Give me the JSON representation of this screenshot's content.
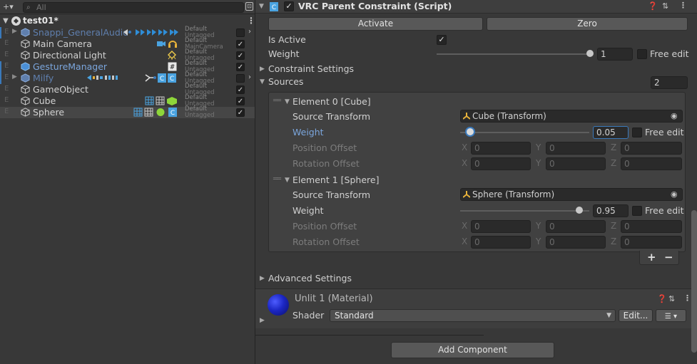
{
  "hierarchy": {
    "search_placeholder": "All",
    "scene_name": "test01*",
    "rows": [
      {
        "name": "Snappi_GeneralAudio",
        "tag_top": "Default",
        "tag_bottom": "Untagged",
        "active": false
      },
      {
        "name": "Main Camera",
        "tag_top": "Default",
        "tag_bottom": "MainCamera",
        "active": true
      },
      {
        "name": "Directional Light",
        "tag_top": "Default",
        "tag_bottom": "Untagged",
        "active": true
      },
      {
        "name": "GestureManager",
        "tag_top": "Default",
        "tag_bottom": "Untagged",
        "active": true
      },
      {
        "name": "Milfy",
        "tag_top": "Default",
        "tag_bottom": "Untagged",
        "active": false
      },
      {
        "name": "GameObject",
        "tag_top": "Default",
        "tag_bottom": "Untagged",
        "active": true
      },
      {
        "name": "Cube",
        "tag_top": "Default",
        "tag_bottom": "Untagged",
        "active": true
      },
      {
        "name": "Sphere",
        "tag_top": "Default",
        "tag_bottom": "Untagged",
        "active": true
      }
    ],
    "row_prefix": "E"
  },
  "inspector": {
    "component_title": "VRC Parent Constraint (Script)",
    "activate_label": "Activate",
    "zero_label": "Zero",
    "is_active_label": "Is Active",
    "weight_label": "Weight",
    "weight_value": "1",
    "weight_fraction": 1.0,
    "free_edit_label": "Free edit",
    "constraint_settings_label": "Constraint Settings",
    "sources_label": "Sources",
    "sources_count": "2",
    "position_offset_label": "Position Offset",
    "rotation_offset_label": "Rotation Offset",
    "source_transform_label": "Source Transform",
    "axis_x": "X",
    "axis_y": "Y",
    "axis_z": "Z",
    "elements": [
      {
        "title": "Element 0 [Cube]",
        "transform": "Cube (Transform)",
        "weight": "0.05",
        "weight_fraction": 0.05,
        "pos": [
          "0",
          "0",
          "0"
        ],
        "rot": [
          "0",
          "0",
          "0"
        ]
      },
      {
        "title": "Element 1 [Sphere]",
        "transform": "Sphere (Transform)",
        "weight": "0.95",
        "weight_fraction": 0.95,
        "pos": [
          "0",
          "0",
          "0"
        ],
        "rot": [
          "0",
          "0",
          "0"
        ]
      }
    ],
    "plus": "+",
    "minus": "−",
    "advanced_settings_label": "Advanced Settings",
    "material_title": "Unlit 1 (Material)",
    "shader_label": "Shader",
    "shader_value": "Standard",
    "edit_label": "Edit...",
    "add_component_label": "Add Component"
  },
  "colors": {
    "accent": "#3a79bb",
    "panel": "#383838",
    "field": "#2a2a2a"
  }
}
